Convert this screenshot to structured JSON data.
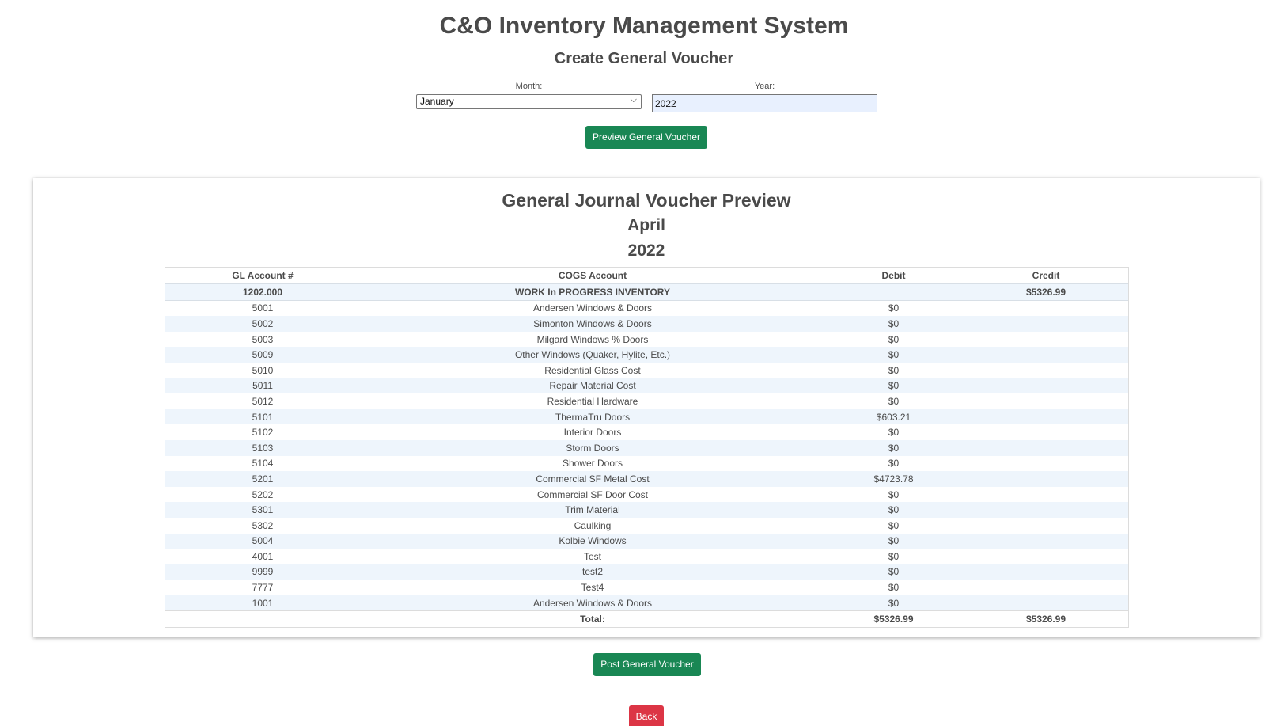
{
  "header": {
    "app_title": "C&O Inventory Management System",
    "page_subtitle": "Create General Voucher"
  },
  "form": {
    "month_label": "Month:",
    "month_value": "January",
    "year_label": "Year:",
    "year_value": "2022",
    "preview_button": "Preview General Voucher"
  },
  "preview": {
    "title": "General Journal Voucher Preview",
    "month": "April",
    "year": "2022",
    "columns": [
      "GL Account #",
      "COGS Account",
      "Debit",
      "Credit"
    ],
    "summary_row": {
      "gl": "1202.000",
      "account": "WORK In PROGRESS INVENTORY",
      "debit": "",
      "credit": "$5326.99"
    },
    "rows": [
      {
        "gl": "5001",
        "account": "Andersen Windows & Doors",
        "debit": "$0",
        "credit": ""
      },
      {
        "gl": "5002",
        "account": "Simonton Windows & Doors",
        "debit": "$0",
        "credit": ""
      },
      {
        "gl": "5003",
        "account": "Milgard Windows % Doors",
        "debit": "$0",
        "credit": ""
      },
      {
        "gl": "5009",
        "account": "Other Windows (Quaker, Hylite, Etc.)",
        "debit": "$0",
        "credit": ""
      },
      {
        "gl": "5010",
        "account": "Residential Glass Cost",
        "debit": "$0",
        "credit": ""
      },
      {
        "gl": "5011",
        "account": "Repair Material Cost",
        "debit": "$0",
        "credit": ""
      },
      {
        "gl": "5012",
        "account": "Residential Hardware",
        "debit": "$0",
        "credit": ""
      },
      {
        "gl": "5101",
        "account": "ThermaTru Doors",
        "debit": "$603.21",
        "credit": ""
      },
      {
        "gl": "5102",
        "account": "Interior Doors",
        "debit": "$0",
        "credit": ""
      },
      {
        "gl": "5103",
        "account": "Storm Doors",
        "debit": "$0",
        "credit": ""
      },
      {
        "gl": "5104",
        "account": "Shower Doors",
        "debit": "$0",
        "credit": ""
      },
      {
        "gl": "5201",
        "account": "Commercial SF Metal Cost",
        "debit": "$4723.78",
        "credit": ""
      },
      {
        "gl": "5202",
        "account": "Commercial SF Door Cost",
        "debit": "$0",
        "credit": ""
      },
      {
        "gl": "5301",
        "account": "Trim Material",
        "debit": "$0",
        "credit": ""
      },
      {
        "gl": "5302",
        "account": "Caulking",
        "debit": "$0",
        "credit": ""
      },
      {
        "gl": "5004",
        "account": "Kolbie Windows",
        "debit": "$0",
        "credit": ""
      },
      {
        "gl": "4001",
        "account": "Test",
        "debit": "$0",
        "credit": ""
      },
      {
        "gl": "9999",
        "account": "test2",
        "debit": "$0",
        "credit": ""
      },
      {
        "gl": "7777",
        "account": "Test4",
        "debit": "$0",
        "credit": ""
      },
      {
        "gl": "1001",
        "account": "Andersen Windows & Doors",
        "debit": "$0",
        "credit": ""
      }
    ],
    "total": {
      "label": "Total:",
      "debit": "$5326.99",
      "credit": "$5326.99"
    }
  },
  "actions": {
    "post_button": "Post General Voucher",
    "back_button": "Back"
  },
  "colors": {
    "primary_green": "#198754",
    "danger_red": "#dc3545",
    "stripe": "#eef5fc"
  }
}
